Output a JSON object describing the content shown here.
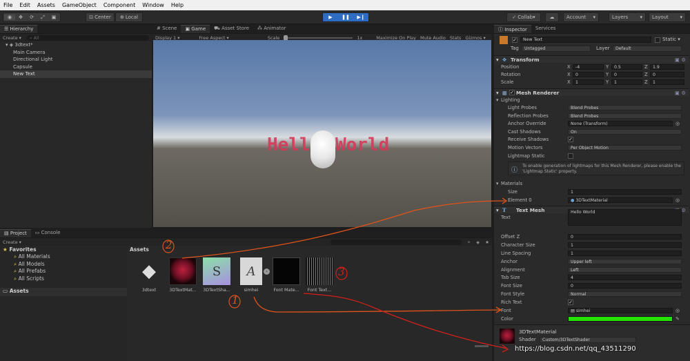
{
  "menu": [
    "File",
    "Edit",
    "Assets",
    "GameObject",
    "Component",
    "Window",
    "Help"
  ],
  "toolbar": {
    "pivot": "Center",
    "space": "Local",
    "collab": "Collab",
    "account": "Account",
    "layers": "Layers",
    "layout": "Layout"
  },
  "hierarchy": {
    "tab": "Hierarchy",
    "create": "Create",
    "search_placeholder": "All",
    "scene": "3dtext*",
    "items": [
      "Main Camera",
      "Directional Light",
      "Capsule",
      "New Text"
    ]
  },
  "game_view": {
    "tabs": [
      "Scene",
      "Game",
      "Asset Store",
      "Animator"
    ],
    "display": "Display 1",
    "aspect": "Free Aspect",
    "scale_label": "Scale",
    "scale_value": "1x",
    "options": [
      "Maximize On Play",
      "Mute Audio",
      "Stats",
      "Gizmos"
    ],
    "text_left": "Hell",
    "text_right": "World",
    "text_color": "#d63a5a"
  },
  "project": {
    "tabs": [
      "Project",
      "Console"
    ],
    "create": "Create",
    "favorites_label": "Favorites",
    "favorites": [
      "All Materials",
      "All Models",
      "All Prefabs",
      "All Scripts"
    ],
    "assets_root": "Assets",
    "breadcrumb": "Assets",
    "assets": [
      {
        "label": "3dtext",
        "icon": "unity-scene-icon"
      },
      {
        "label": "3DTextMat...",
        "icon": "material-icon"
      },
      {
        "label": "3DTextSha...",
        "icon": "shader-icon"
      },
      {
        "label": "simhei",
        "icon": "font-icon"
      },
      {
        "label": "Font Mate...",
        "icon": "font-material-icon"
      },
      {
        "label": "Font Text...",
        "icon": "font-texture-icon"
      }
    ]
  },
  "inspector": {
    "tabs": [
      "Inspector",
      "Services"
    ],
    "object_name": "New Text",
    "static_label": "Static",
    "tag_label": "Tag",
    "tag_value": "Untagged",
    "layer_label": "Layer",
    "layer_value": "Default",
    "transform": {
      "title": "Transform",
      "rows": [
        {
          "label": "Position",
          "x": "-4",
          "y": "0.5",
          "z": "1.9"
        },
        {
          "label": "Rotation",
          "x": "0",
          "y": "0",
          "z": "0"
        },
        {
          "label": "Scale",
          "x": "1",
          "y": "1",
          "z": "1"
        }
      ]
    },
    "mesh_renderer": {
      "title": "Mesh Renderer",
      "lighting_label": "Lighting",
      "rows": [
        {
          "label": "Light Probes",
          "value": "Blend Probes"
        },
        {
          "label": "Reflection Probes",
          "value": "Blend Probes"
        },
        {
          "label": "Anchor Override",
          "value": "None (Transform)"
        },
        {
          "label": "Cast Shadows",
          "value": "On"
        },
        {
          "label": "Receive Shadows",
          "value": "✓"
        },
        {
          "label": "Motion Vectors",
          "value": "Per Object Motion"
        },
        {
          "label": "Lightmap Static",
          "value": ""
        }
      ],
      "info": "To enable generation of lightmaps for this Mesh Renderer, please enable the 'Lightmap Static' property.",
      "materials_label": "Materials",
      "size_label": "Size",
      "size_value": "1",
      "element_label": "Element 0",
      "element_value": "3DTextMaterial"
    },
    "text_mesh": {
      "title": "Text Mesh",
      "rows": [
        {
          "label": "Text",
          "value": "Hello World"
        },
        {
          "label": "Offset Z",
          "value": "0"
        },
        {
          "label": "Character Size",
          "value": "1"
        },
        {
          "label": "Line Spacing",
          "value": "1"
        },
        {
          "label": "Anchor",
          "value": "Upper left"
        },
        {
          "label": "Alignment",
          "value": "Left"
        },
        {
          "label": "Tab Size",
          "value": "4"
        },
        {
          "label": "Font Size",
          "value": "0"
        },
        {
          "label": "Font Style",
          "value": "Normal"
        },
        {
          "label": "Rich Text",
          "value": "✓"
        },
        {
          "label": "Font",
          "value": "simhei"
        },
        {
          "label": "Color",
          "value": ""
        }
      ],
      "color_hex": "#25e000"
    },
    "material": {
      "name": "3DTextMaterial",
      "shader_label": "Shader",
      "shader_value": "Custom/3DTextShader"
    }
  },
  "annotations": {
    "one": "1",
    "two": "2",
    "three": "3",
    "watermark": "https://blog.csdn.net/qq_43511290"
  }
}
